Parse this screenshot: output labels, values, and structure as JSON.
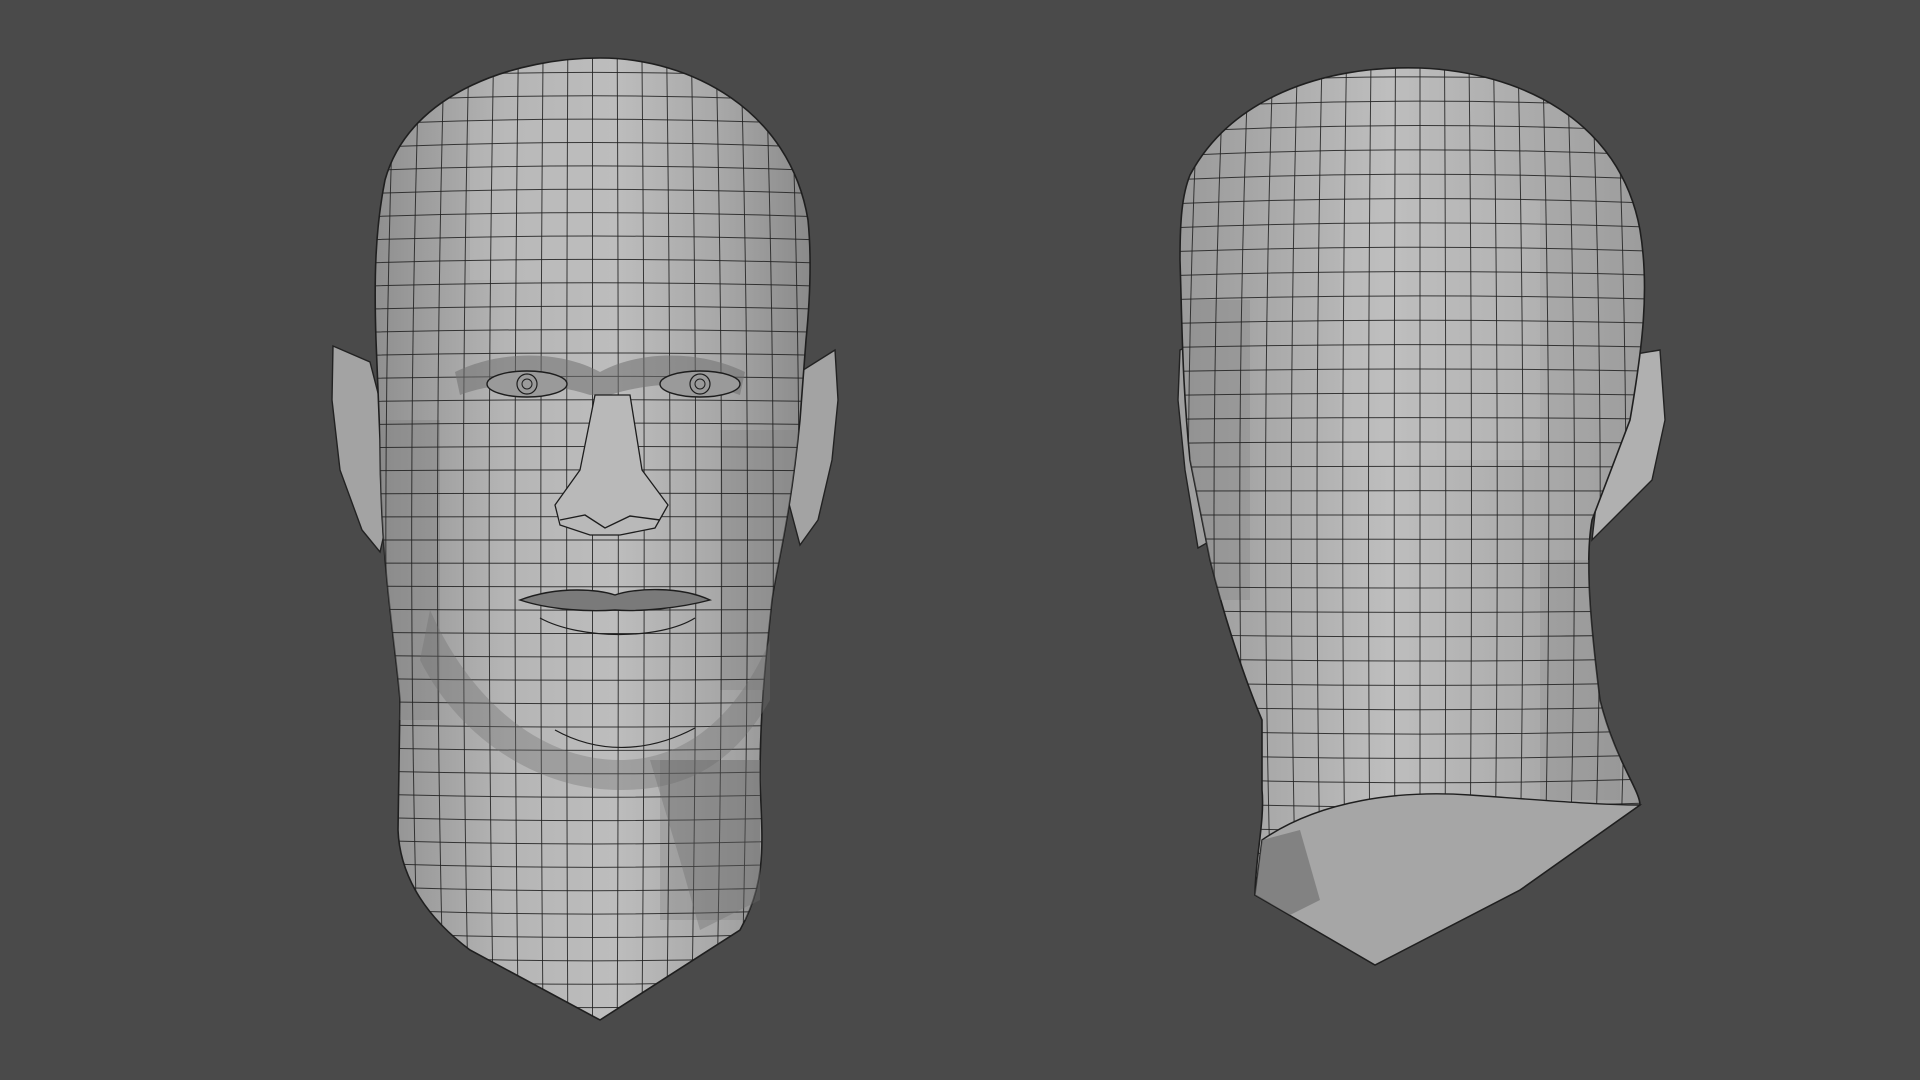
{
  "scene": {
    "background": "#4a4a4a",
    "mesh_fill": "#a9a9a9",
    "mesh_fill_light": "#c1c1c1",
    "mesh_fill_shadow": "#848484",
    "wire_color": "#202020",
    "objects": [
      {
        "view": "front",
        "subject": "head-mesh"
      },
      {
        "view": "back",
        "subject": "head-mesh"
      }
    ]
  }
}
